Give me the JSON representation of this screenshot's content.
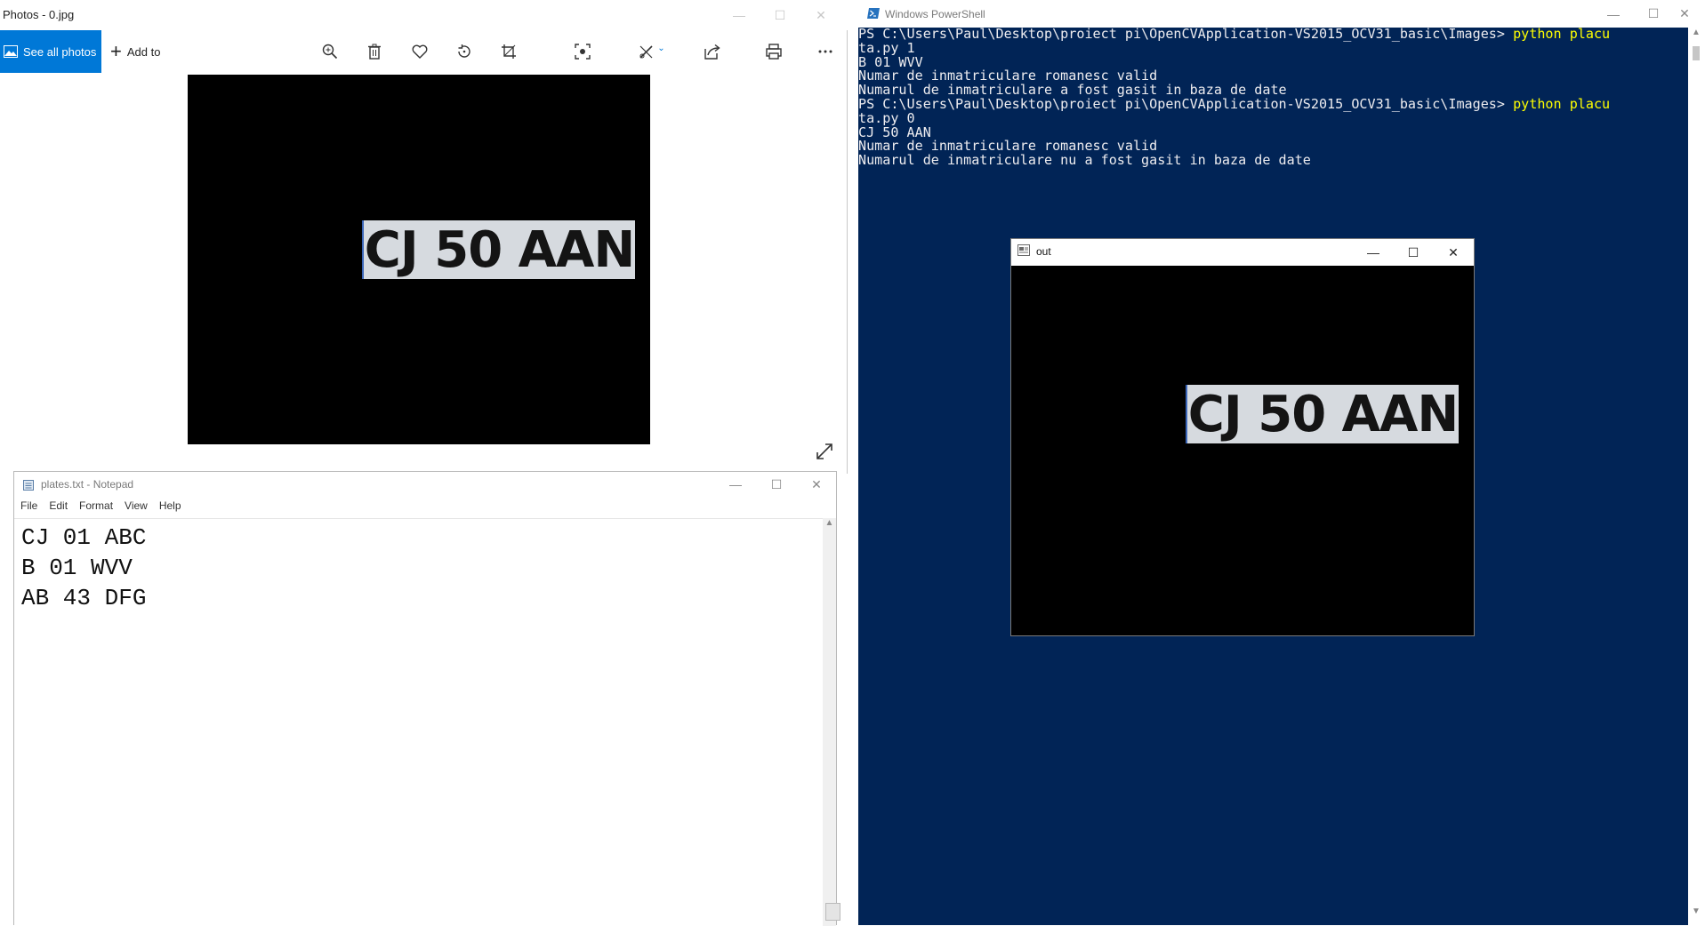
{
  "photos": {
    "title": "Photos - 0.jpg",
    "see_all_label": "See all photos",
    "add_to_label": "Add to",
    "plate_text": "CJ 50 AAN",
    "toolbar_icons": [
      "zoom-icon",
      "delete-icon",
      "favorite-icon",
      "rotate-icon",
      "crop-icon",
      "enhance-icon",
      "edit-icon",
      "share-icon",
      "print-icon",
      "more-icon"
    ]
  },
  "notepad": {
    "title": "plates.txt - Notepad",
    "menu": [
      "File",
      "Edit",
      "Format",
      "View",
      "Help"
    ],
    "lines": [
      "CJ 01 ABC",
      "B 01 WVV",
      "AB 43 DFG"
    ]
  },
  "powershell": {
    "title": "Windows PowerShell",
    "lines": [
      {
        "text": "PS C:\\Users\\Paul\\Desktop\\proiect pi\\OpenCVApplication-VS2015_OCV31_basic\\Images> ",
        "cmd": "python placu"
      },
      {
        "text": "ta.py 1",
        "cmd": ""
      },
      {
        "text": "B 01 WVV",
        "cmd": ""
      },
      {
        "text": "Numar de inmatriculare romanesc valid",
        "cmd": ""
      },
      {
        "text": "Numarul de inmatriculare a fost gasit in baza de date",
        "cmd": ""
      },
      {
        "text": "PS C:\\Users\\Paul\\Desktop\\proiect pi\\OpenCVApplication-VS2015_OCV31_basic\\Images> ",
        "cmd": "python placu"
      },
      {
        "text": "ta.py 0",
        "cmd": ""
      },
      {
        "text": "CJ 50 AAN",
        "cmd": ""
      },
      {
        "text": "Numar de inmatriculare romanesc valid",
        "cmd": ""
      },
      {
        "text": "Numarul de inmatriculare nu a fost gasit in baza de date",
        "cmd": ""
      }
    ],
    "background_color": "#012456",
    "command_color": "#ffff00"
  },
  "out_window": {
    "title": "out",
    "plate_text": "CJ 50 AAN"
  },
  "colors": {
    "accent": "#0078d7"
  }
}
